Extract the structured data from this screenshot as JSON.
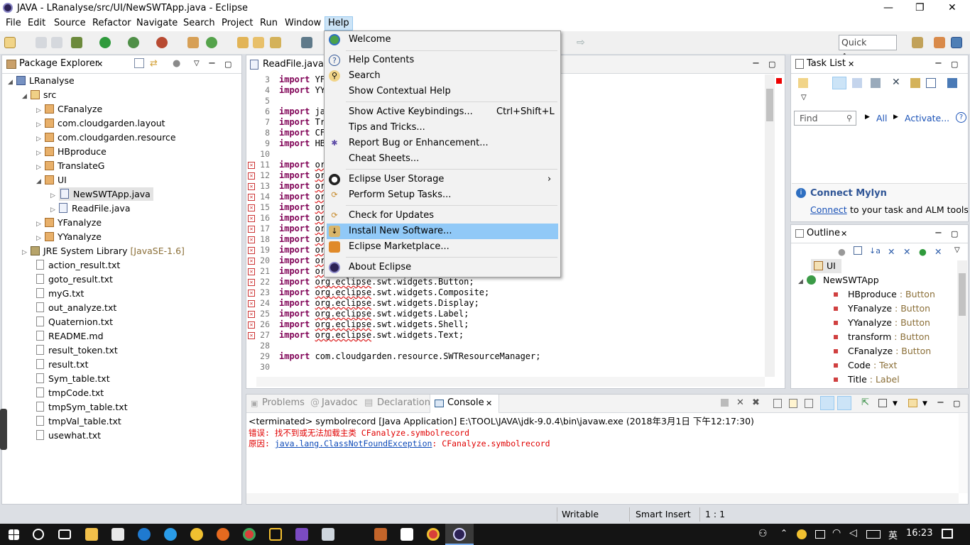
{
  "window": {
    "title": "JAVA - LRanalyse/src/UI/NewSWTApp.java - Eclipse"
  },
  "menubar": [
    "File",
    "Edit",
    "Source",
    "Refactor",
    "Navigate",
    "Search",
    "Project",
    "Run",
    "Window",
    "Help"
  ],
  "toolbar": {
    "quick_access": "Quick Access"
  },
  "package_explorer": {
    "title": "Package Explorer",
    "items": [
      {
        "label": "LRanalyse"
      },
      {
        "label": "src"
      },
      {
        "label": "CFanalyze"
      },
      {
        "label": "com.cloudgarden.layout"
      },
      {
        "label": "com.cloudgarden.resource"
      },
      {
        "label": "HBproduce"
      },
      {
        "label": "TranslateG"
      },
      {
        "label": "UI"
      },
      {
        "label": "NewSWTApp.java"
      },
      {
        "label": "ReadFile.java"
      },
      {
        "label": "YFanalyze"
      },
      {
        "label": "YYanalyze"
      },
      {
        "label": "JRE System Library",
        "extra": "[JavaSE-1.6]"
      },
      {
        "label": "action_result.txt"
      },
      {
        "label": "goto_result.txt"
      },
      {
        "label": "myG.txt"
      },
      {
        "label": "out_analyze.txt"
      },
      {
        "label": "Quaternion.txt"
      },
      {
        "label": "README.md"
      },
      {
        "label": "result_token.txt"
      },
      {
        "label": "result.txt"
      },
      {
        "label": "Sym_table.txt"
      },
      {
        "label": "tmpCode.txt"
      },
      {
        "label": "tmpSym_table.txt"
      },
      {
        "label": "tmpVal_table.txt"
      },
      {
        "label": "usewhat.txt"
      }
    ]
  },
  "editor": {
    "tab": "ReadFile.java",
    "lines": [
      {
        "n": "3",
        "t": "import YF"
      },
      {
        "n": "4",
        "t": "import YY"
      },
      {
        "n": "5",
        "t": ""
      },
      {
        "n": "6",
        "t": "import ja"
      },
      {
        "n": "7",
        "t": "import Tr"
      },
      {
        "n": "8",
        "t": "import CF"
      },
      {
        "n": "9",
        "t": "import HB"
      },
      {
        "n": "10",
        "t": ""
      },
      {
        "n": "11",
        "t": "import or"
      },
      {
        "n": "12",
        "t": "import or"
      },
      {
        "n": "13",
        "t": "import or"
      },
      {
        "n": "14",
        "t": "import or"
      },
      {
        "n": "15",
        "t": "import or"
      },
      {
        "n": "16",
        "t": "import or"
      },
      {
        "n": "17",
        "t": "import or"
      },
      {
        "n": "18",
        "t": "import or"
      },
      {
        "n": "19",
        "t": "import or"
      },
      {
        "n": "20",
        "t": "import or"
      },
      {
        "n": "21",
        "t": "import or"
      },
      {
        "n": "22",
        "t": "import org.eclipse.swt.widgets.Button;"
      },
      {
        "n": "23",
        "t": "import org.eclipse.swt.widgets.Composite;"
      },
      {
        "n": "24",
        "t": "import org.eclipse.swt.widgets.Display;"
      },
      {
        "n": "25",
        "t": "import org.eclipse.swt.widgets.Label;"
      },
      {
        "n": "26",
        "t": "import org.eclipse.swt.widgets.Shell;"
      },
      {
        "n": "27",
        "t": "import org.eclipse.swt.widgets.Text;"
      },
      {
        "n": "28",
        "t": ""
      },
      {
        "n": "29",
        "t": "import com.cloudgarden.resource.SWTResourceManager;"
      },
      {
        "n": "30",
        "t": ""
      }
    ]
  },
  "help_menu": {
    "items": [
      {
        "label": "Welcome",
        "shortcut": ""
      },
      {
        "label": "Help Contents",
        "shortcut": ""
      },
      {
        "label": "Search",
        "shortcut": ""
      },
      {
        "label": "Show Contextual Help",
        "shortcut": ""
      },
      {
        "label": "Show Active Keybindings...",
        "shortcut": "Ctrl+Shift+L"
      },
      {
        "label": "Tips and Tricks...",
        "shortcut": ""
      },
      {
        "label": "Report Bug or Enhancement...",
        "shortcut": ""
      },
      {
        "label": "Cheat Sheets...",
        "shortcut": ""
      },
      {
        "label": "Eclipse User Storage",
        "shortcut": "›"
      },
      {
        "label": "Perform Setup Tasks...",
        "shortcut": ""
      },
      {
        "label": "Check for Updates",
        "shortcut": ""
      },
      {
        "label": "Install New Software...",
        "shortcut": ""
      },
      {
        "label": "Eclipse Marketplace...",
        "shortcut": ""
      },
      {
        "label": "About Eclipse",
        "shortcut": ""
      }
    ]
  },
  "task_list": {
    "title": "Task List",
    "find_placeholder": "Find",
    "all": "All",
    "activate": "Activate...",
    "mylyn_title": "Connect Mylyn",
    "mylyn_link": "Connect",
    "mylyn_text": "to your task and ALM tools o"
  },
  "outline": {
    "title": "Outline",
    "items": [
      {
        "name": "UI",
        "type": ""
      },
      {
        "name": "NewSWTApp",
        "type": ""
      },
      {
        "name": "HBproduce",
        "type": " : Button"
      },
      {
        "name": "YFanalyze",
        "type": " : Button"
      },
      {
        "name": "YYanalyze",
        "type": " : Button"
      },
      {
        "name": "transform",
        "type": " : Button"
      },
      {
        "name": "CFanalyze",
        "type": " : Button"
      },
      {
        "name": "Code",
        "type": " : Text"
      },
      {
        "name": "Title",
        "type": " : Label"
      }
    ]
  },
  "bottom_tabs": [
    "Problems",
    "Javadoc",
    "Declaration",
    "Console"
  ],
  "console": {
    "header": "<terminated> symbolrecord [Java Application] E:\\TOOL\\JAVA\\jdk-9.0.4\\bin\\javaw.exe (2018年3月1日 下午12:17:30)",
    "line1": "错误: 找不到或无法加载主类 CFanalyze.symbolrecord",
    "line2_prefix": "原因: ",
    "line2_link": "java.lang.ClassNotFoundException",
    "line2_rest": ": CFanalyze.symbolrecord"
  },
  "status": {
    "writable": "Writable",
    "insert": "Smart Insert",
    "pos": "1 : 1"
  },
  "taskbar": {
    "ime": "英",
    "time": "16:23"
  },
  "colors": {
    "menu_highlight": "#91c9f7",
    "error_red": "#e00000",
    "link_blue": "#0b48b7"
  }
}
